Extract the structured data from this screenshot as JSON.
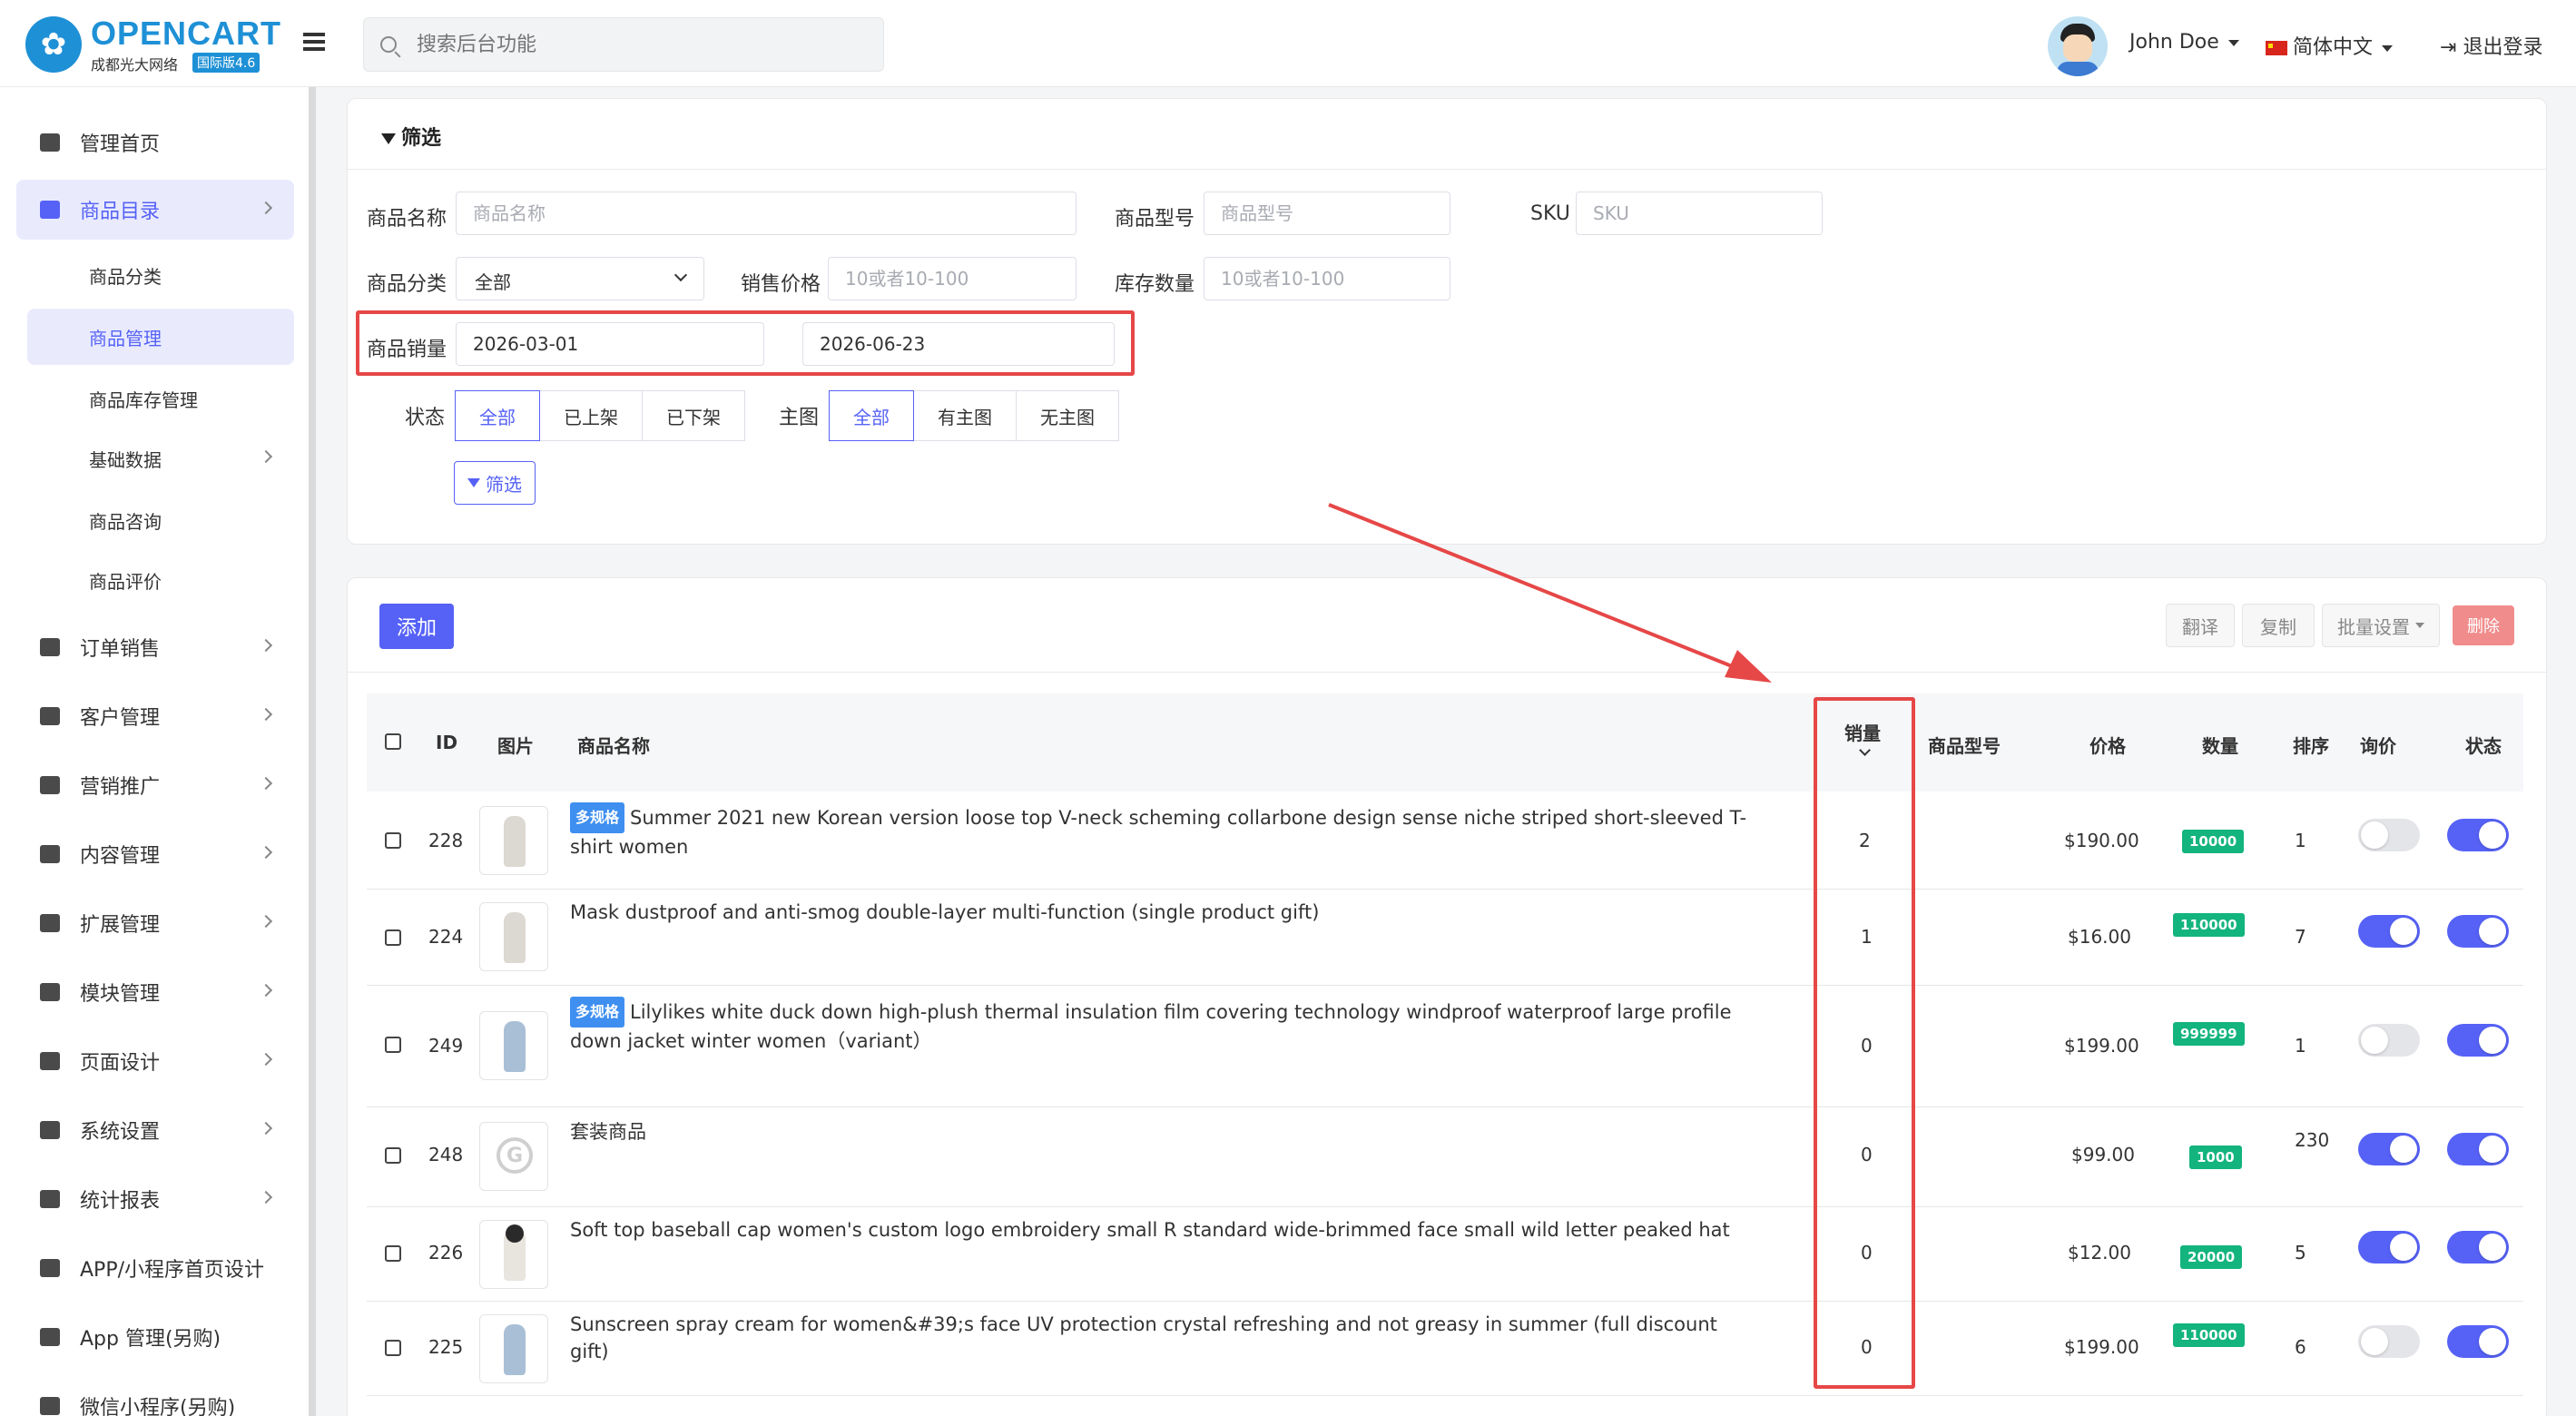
{
  "header": {
    "brand": "OPENCART",
    "brand_sub": "成都光大网络",
    "version": "国际版4.6",
    "search_placeholder": "搜索后台功能",
    "user": "John Doe",
    "language": "简体中文",
    "logout": "退出登录"
  },
  "sidebar": {
    "items": [
      {
        "label": "管理首页",
        "icon": "dashboard-icon"
      },
      {
        "label": "商品目录",
        "icon": "tag-icon"
      },
      {
        "label": "订单销售",
        "icon": "cart-icon"
      },
      {
        "label": "客户管理",
        "icon": "user-icon"
      },
      {
        "label": "营销推广",
        "icon": "share-icon"
      },
      {
        "label": "内容管理",
        "icon": "book-icon"
      },
      {
        "label": "扩展管理",
        "icon": "puzzle-icon"
      },
      {
        "label": "模块管理",
        "icon": "cube-icon"
      },
      {
        "label": "页面设计",
        "icon": "desktop-icon"
      },
      {
        "label": "系统设置",
        "icon": "gear-icon"
      },
      {
        "label": "统计报表",
        "icon": "bar-chart-icon"
      },
      {
        "label": "APP/小程序首页设计",
        "icon": "mobile-icon"
      },
      {
        "label": "App 管理(另购)",
        "icon": "apple-icon"
      },
      {
        "label": "微信小程序(另购)",
        "icon": "wechat-icon"
      }
    ],
    "subitems": [
      "商品分类",
      "商品管理",
      "商品库存管理",
      "基础数据",
      "商品咨询",
      "商品评价"
    ]
  },
  "filter": {
    "title": "筛选",
    "name_label": "商品名称",
    "name_placeholder": "商品名称",
    "model_label": "商品型号",
    "model_placeholder": "商品型号",
    "sku_label": "SKU",
    "sku_placeholder": "SKU",
    "category_label": "商品分类",
    "category_value": "全部",
    "price_label": "销售价格",
    "price_placeholder": "10或者10-100",
    "stock_label": "库存数量",
    "stock_placeholder": "10或者10-100",
    "sales_label": "商品销量",
    "sales_from": "2026-03-01",
    "sales_to": "2026-06-23",
    "status_label": "状态",
    "status_options": [
      "全部",
      "已上架",
      "已下架"
    ],
    "image_label": "主图",
    "image_options": [
      "全部",
      "有主图",
      "无主图"
    ],
    "submit": "筛选"
  },
  "toolbar": {
    "add": "添加",
    "translate": "翻译",
    "copy": "复制",
    "batch": "批量设置",
    "delete": "删除"
  },
  "table": {
    "headers": {
      "id": "ID",
      "image": "图片",
      "name": "商品名称",
      "sales": "销量",
      "model": "商品型号",
      "price": "价格",
      "quantity": "数量",
      "sort": "排序",
      "inquiry": "询价",
      "status": "状态"
    },
    "rows": [
      {
        "id": "228",
        "tag": "多规格",
        "name": "Summer 2021 new Korean version loose top V-neck scheming collarbone design sense niche striped short-sleeved T-shirt women",
        "sales": "2",
        "price": "$190.00",
        "quantity": "10000",
        "sort": "1",
        "inquiry": false,
        "status": true
      },
      {
        "id": "224",
        "tag": "",
        "name": "Mask dustproof and anti-smog double-layer multi-function (single product gift)",
        "sales": "1",
        "price": "$16.00",
        "quantity": "110000",
        "sort": "7",
        "inquiry": true,
        "status": true
      },
      {
        "id": "249",
        "tag": "多规格",
        "name": "Lilylikes white duck down high-plush thermal insulation film covering technology windproof waterproof large profile down jacket winter women（variant）",
        "sales": "0",
        "price": "$199.00",
        "quantity": "999999",
        "sort": "1",
        "inquiry": false,
        "status": true
      },
      {
        "id": "248",
        "tag": "",
        "name": "套装商品",
        "sales": "0",
        "price": "$99.00",
        "quantity": "1000",
        "sort": "230",
        "inquiry": true,
        "status": true
      },
      {
        "id": "226",
        "tag": "",
        "name": "Soft top baseball cap women's custom logo embroidery small R standard wide-brimmed face small wild letter peaked hat",
        "sales": "0",
        "price": "$12.00",
        "quantity": "20000",
        "sort": "5",
        "inquiry": true,
        "status": true
      },
      {
        "id": "225",
        "tag": "",
        "name": "Sunscreen spray cream for women&#39;s face UV protection crystal refreshing and not greasy in summer (full discount gift)",
        "sales": "0",
        "price": "$199.00",
        "quantity": "110000",
        "sort": "6",
        "inquiry": false,
        "status": true
      }
    ]
  },
  "colors": {
    "accent": "#5662f6",
    "highlight": "#e64747",
    "badge": "#13b47e",
    "tag": "#3e8ff0"
  }
}
